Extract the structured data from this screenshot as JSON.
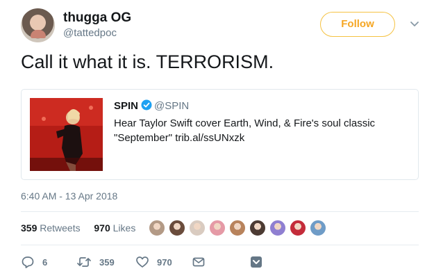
{
  "tweet": {
    "display_name": "thugga OG",
    "handle": "@tattedpoc",
    "follow_label": "Follow",
    "text": "Call it what it is. TERRORISM.",
    "timestamp": "6:40 AM - 13 Apr 2018"
  },
  "quoted": {
    "name": "SPIN",
    "handle": "@SPIN",
    "text": "Hear Taylor Swift cover Earth, Wind, & Fire's soul classic \"September\" trib.al/ssUNxzk"
  },
  "stats": {
    "retweets_count": "359",
    "retweets_label": "Retweets",
    "likes_count": "970",
    "likes_label": "Likes",
    "liker_avatar_colors": [
      "#b39a86",
      "#6a4c3c",
      "#d9cbc0",
      "#e59aa6",
      "#b8835c",
      "#4c3b33",
      "#8f7fd1",
      "#c42c3a",
      "#6f9cc7"
    ]
  },
  "actions": {
    "reply_count": "6",
    "retweet_count": "359",
    "like_count": "970"
  },
  "colors": {
    "follow_accent": "#f5a623",
    "verified": "#1da1f2",
    "muted": "#657786"
  },
  "icons": [
    "chevron-down-icon",
    "verified-badge-icon",
    "reply-icon",
    "retweet-icon",
    "heart-icon",
    "envelope-icon",
    "bookmark-icon"
  ]
}
